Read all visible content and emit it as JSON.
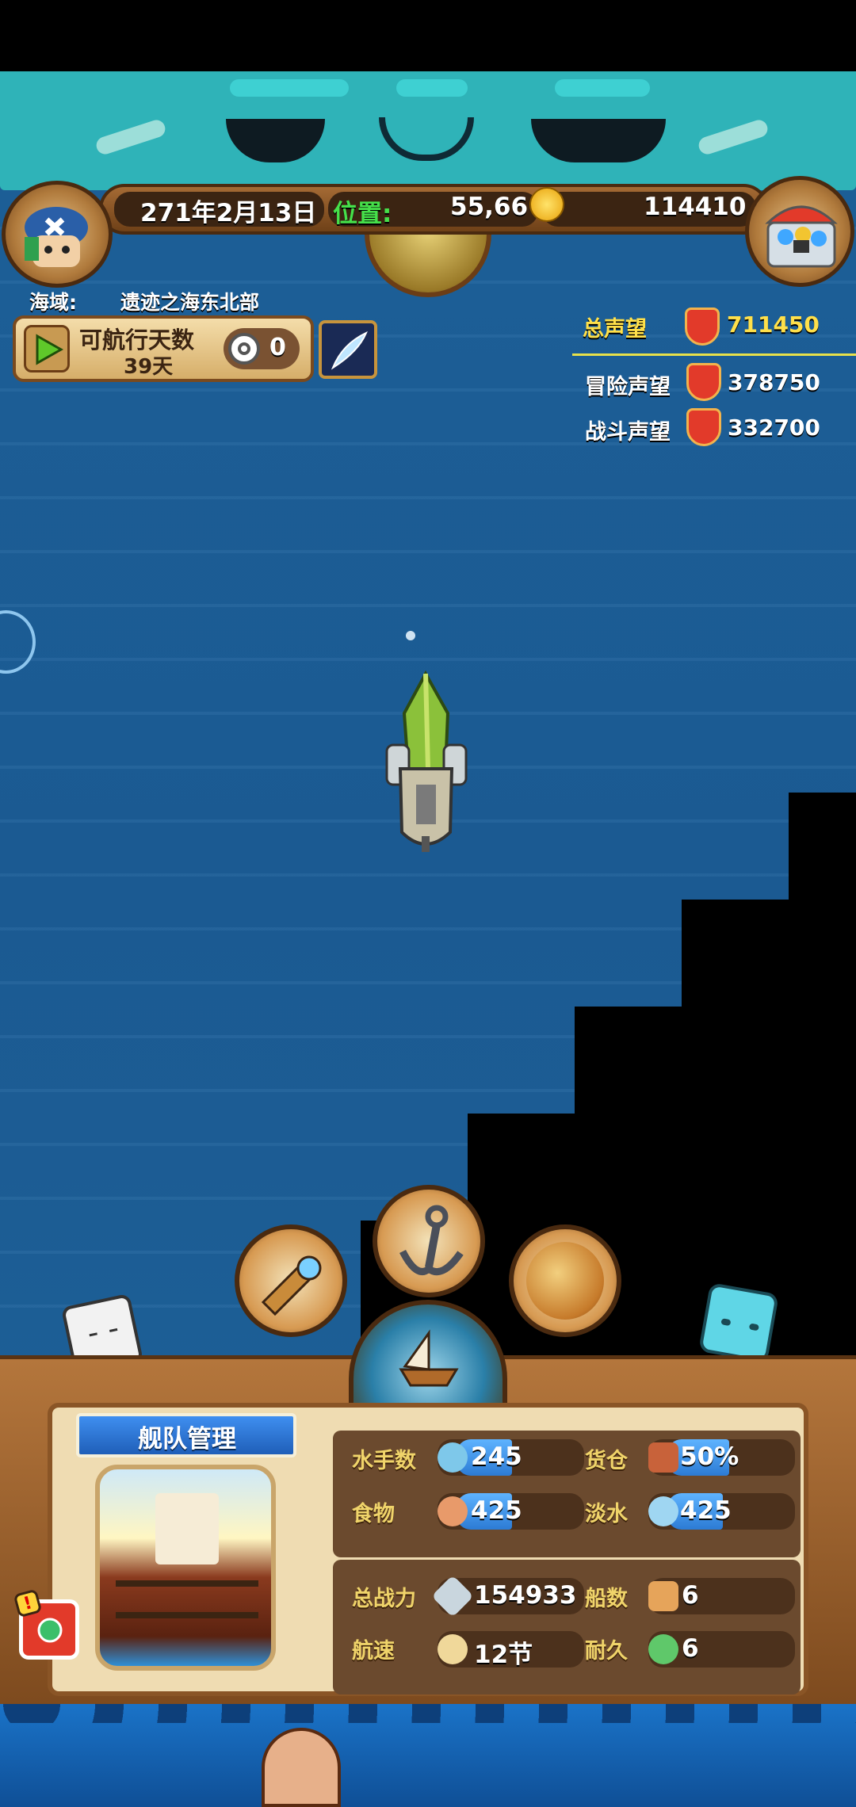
{
  "header": {
    "date": "271年2月13日",
    "position_label": "位置:",
    "position_value": "55,66",
    "gold": "114410"
  },
  "region": {
    "label": "海域:",
    "name": "遗迹之海东北部"
  },
  "voyage": {
    "title": "可航行天数",
    "days": "39天",
    "count": "0"
  },
  "reputation": {
    "total_label": "总声望",
    "total_value": "711450",
    "adventure_label": "冒险声望",
    "adventure_value": "378750",
    "battle_label": "战斗声望",
    "battle_value": "332700"
  },
  "fleet": {
    "title": "舰队管理",
    "sailors_label": "水手数",
    "sailors_value": "245",
    "cargo_label": "货仓",
    "cargo_value": "50%",
    "food_label": "食物",
    "food_value": "425",
    "water_label": "淡水",
    "water_value": "425",
    "power_label": "总战力",
    "power_value": "154933",
    "ships_label": "船数",
    "ships_value": "6",
    "speed_label": "航速",
    "speed_value": "12节",
    "durability_label": "耐久",
    "durability_value": "6"
  },
  "colors": {
    "sea": "#1b5a92",
    "accent_yellow": "#ffe04a",
    "banner_teal": "#2fb3b8",
    "wood": "#8a5526"
  },
  "icons": [
    "avatar-pirate-icon",
    "treasure-chest-icon",
    "gold-coin-icon",
    "play-icon",
    "target-icon",
    "feather-icon",
    "spyglass-icon",
    "anchor-icon",
    "world-map-icon",
    "ship-icon",
    "sailor-icon",
    "crate-icon",
    "meat-icon",
    "water-jug-icon",
    "crossed-swords-icon",
    "boot-icon",
    "moon-ship-icon",
    "wrench-icon",
    "alert-icon"
  ]
}
